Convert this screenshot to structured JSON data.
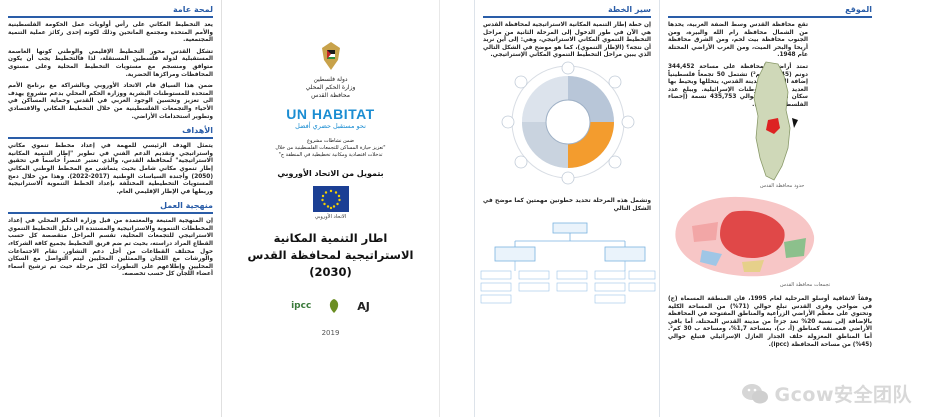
{
  "panel_general": {
    "h1": "لمحة عامة",
    "t1": "يعد التخطيط المكاني على رأس أولويات عمل الحكومة الفلسطينية والأمم المتحدة ومجتمع المانحين وذلك لكونه إحدى ركائز عملية التنمية المجتمعية.",
    "t2": "تشكل القدس محور التخطيط الإقليمي والوطني كونها العاصمة المستقبلية لدولة فلسطين المستقلة، لذا فالتخطيط يجب أن يكون متوافق ومنسجم مع مستويات التخطيط المحلية وعلى مستوى المحافظات ومراكزها الحضرية.",
    "t3": "ضمن هذا السياق قام الاتحاد الأوروبي وبالشراكة مع برنامج الأمم المتحدة للمستوطنات البشرية ووزارة الحكم المحلي بدعم مشروع يهدف الى تعزيز وتحسين الوجود العربي في القدس وحماية المساكن في الأحياء والتجمعات الفلسطينية من خلال التخطيط المكاني والاقتصادي وتطوير استخدامات الأراضي.",
    "h2": "الأهداف",
    "t4": "يتمثل الهدف الرئيسي للمهمة في إعداد مخطط تنموي مكاني واستراتيجي وتقديم الدعم الفني في تطوير \"إطار التنمية المكانية الاستراتيجية\" لمحافظة القدس، والذي تعتبر عنصراً حاسماً في تحقيق إطار تنموي مكاني شامل بحيث يتماشى مع المخطط الوطني المكاني (2050) وأجندة السياسات الوطنية (2017-2022). وهذا من خلال دمج المستويات التخطيطية المختلفة بإعداد الخطط التنموية الاستراتيجية وربطها في الإطار الإقليمي العام.",
    "h3": "منهجية العمل",
    "t5": "إن المنهجية المتبعة والمعتمدة من قبل وزارة الحكم المحلي في إعداد المخططات التنموية والاستراتيجية والمستندة الى دليل التخطيط التنموي الاستراتيجي للتجمعات المحلية، تقسم المراحل متقصصة كل حسب القطاع المراد دراسته، بحيث تم ضم فريق التخطيط بجميع كافة الشركاء، حول مختلف القطاعات من أجل دعم التشاور. تقام الاجتماعات والورشات مع اللجان والممثلين المحليين ليتم التواصل مع السكان المحليين وإطلاعهم على التطورات لكل مرحلة حيث تم ترشيح أسماء أعضاء اللجان كل حسب تخصصه."
  },
  "panel_cover": {
    "state": "دولة فلسطين",
    "ministry": "وزارة الحكم المحلي",
    "gov": "محافظة القدس",
    "unhabitat": "UN HABITAT",
    "unhabitat_sub": "نحو مستقبل حضري أفضل",
    "project1": "ضمن نشاطات مشروع",
    "project2": "\"تعزيز حيازة المساكن للتجمعات الفلسطينية من خلال",
    "project3": "تدخلات اقتصادية ومكانية تخطيطية في المنطقة ج\"",
    "funded": "بتمويل من الاتحاد الأوروبي",
    "eu_caption": "الاتحاد الأوروبي",
    "title_l1": "اطار التنمية المكانية",
    "title_l2": "الاستراتيجية لمحافظة القدس",
    "title_l3": "(2030)",
    "logo1": "ipcc",
    "logo2": "AJ",
    "year": "2019"
  },
  "panel_plan": {
    "h": "سير الخطة",
    "t1": "إن خطة إطار التنمية المكانية الاستراتيجية لمحافظة القدس هي الآن في طور الدخول إلى المرحلة الثانية من مراحل التخطيط التنموي المكاني الاستراتيجي، وهي: إلى أين نريد أن نتجه؟ (الإطار التنموي)، كما هو موضح في الشكل التالي الذي يبين مراحل التخطيط التنموي المكاني الإستراتيجي.",
    "t2": "وتشمل هذه المرحلة تحديد خطوتين مهمتين كما موضح في الشكل التالي"
  },
  "panel_location": {
    "h": "الموقع",
    "t1": "تقع محافظة القدس وسط الضفة الغربية، يحدها من الشمال محافظة رام الله والبيرة، ومن الجنوب محافظة بيت لحم، ومن الشرق محافظة أريحا والبحر الميت، ومن الغرب الأراضي المحتلة عام 1948.",
    "t2": "تمتد أراضي المحافظة على مساحة 344,452 دونم (344.45 كم²) تشتمل 50 تجمعاً فلسطينياً إضافة الى أحياء مدينة القدس، يتخللها ويحيط بها العديد من المستوطنات الإسرائيلية. ويبلغ عدد سكان المحافظة حوالي 435,753 نسمة (إحصاء الفلسطيني 2017).",
    "cap1": "حدود محافظة القدس",
    "cap2": "تجمعات محافظة القدس",
    "t3": "وفقاً لاتفاقية أوسلو المرحلية لعام 1995، فان المنطقة المسماة (ج) في ضواحي وقرى القدس تبلغ حوالي (71%) من المساحة الكلية وتحتوي على معظم الأراضي الزراعية والمناطق المفتوحة في المحافظة بالإضافة إلى نسبة 20% تعد جزءاً من مدينة القدس المحتلة، أما باقي الأراضي قمصنفة كمناطق (أ، ب)، بمساحة 1,7%، ومساحة ب 30 كم². أما المناطق المعزولة خلف الجدار العازل الإسرائيلي فتبلغ حوالي (45%) من مساحة المحافظة (ipcc)."
  },
  "watermark": {
    "text": "Gcow安全团队"
  }
}
